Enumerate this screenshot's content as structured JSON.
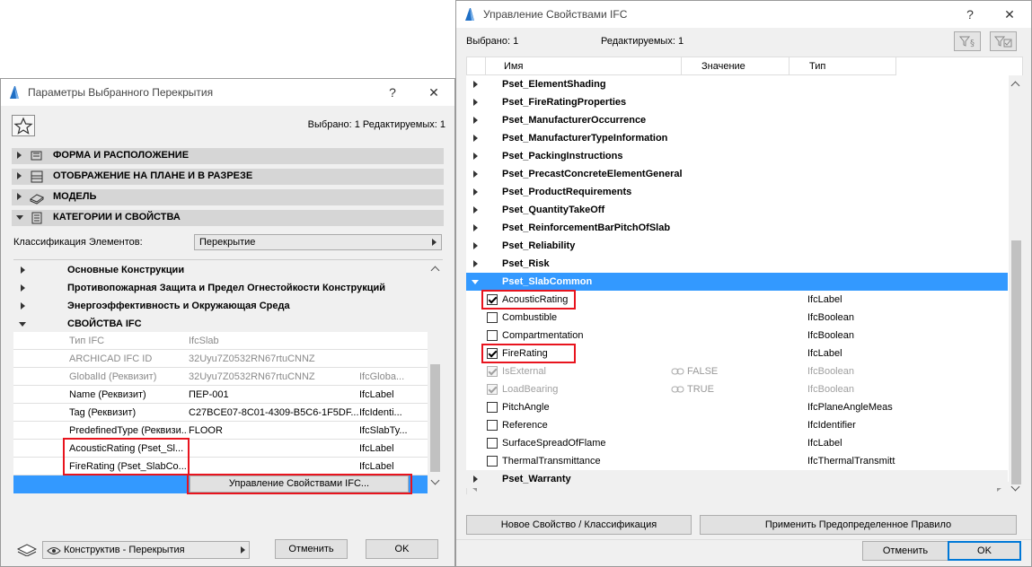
{
  "left_window": {
    "title": "Параметры Выбранного Перекрытия",
    "help": "?",
    "close": "✕",
    "selection_info": "Выбрано: 1 Редактируемых: 1",
    "sections": [
      {
        "label": "ФОРМА И РАСПОЛОЖЕНИЕ"
      },
      {
        "label": "ОТОБРАЖЕНИЕ НА ПЛАНЕ И В РАЗРЕЗЕ"
      },
      {
        "label": "МОДЕЛЬ"
      },
      {
        "label": "КАТЕГОРИИ И СВОЙСТВА"
      }
    ],
    "classification_label": "Классификация Элементов:",
    "classification_value": "Перекрытие",
    "groups": [
      {
        "label": "Основные Конструкции"
      },
      {
        "label": "Противопожарная Защита и Предел Огнестойкости Конструкций"
      },
      {
        "label": "Энергоэффективность и Окружающая Среда"
      },
      {
        "label": "СВОЙСТВА IFC"
      }
    ],
    "rows": [
      {
        "name": "Тип IFC",
        "value": "IfcSlab",
        "type": ""
      },
      {
        "name": "ARCHICAD IFC ID",
        "value": "32Uyu7Z0532RN67rtuCNNZ",
        "type": ""
      },
      {
        "name": "GlobalId (Реквизит)",
        "value": "32Uyu7Z0532RN67rtuCNNZ",
        "type": "IfcGloba..."
      },
      {
        "name": "Name (Реквизит)",
        "value": "ПЕР-001",
        "type": "IfcLabel"
      },
      {
        "name": "Tag (Реквизит)",
        "value": "C27BCE07-8C01-4309-B5C6-1F5DF...",
        "type": "IfcIdenti..."
      },
      {
        "name": "PredefinedType (Реквизи...",
        "value": "FLOOR",
        "type": "IfcSlabTy..."
      },
      {
        "name": "AcousticRating (Pset_Sl...",
        "value": "",
        "type": "IfcLabel"
      },
      {
        "name": "FireRating (Pset_SlabCo...",
        "value": "",
        "type": "IfcLabel"
      }
    ],
    "manage_button": "Управление Свойствами IFC...",
    "layer_value": "Конструктив - Перекрытия",
    "cancel": "Отменить",
    "ok": "OK"
  },
  "right_window": {
    "title": "Управление Свойствами IFC",
    "help": "?",
    "close": "✕",
    "selected_label": "Выбрано: 1",
    "editable_label": "Редактируемых: 1",
    "columns": {
      "name": "Имя",
      "value": "Значение",
      "type": "Тип"
    },
    "groups_top": [
      "Pset_ElementShading",
      "Pset_FireRatingProperties",
      "Pset_ManufacturerOccurrence",
      "Pset_ManufacturerTypeInformation",
      "Pset_PackingInstructions",
      "Pset_PrecastConcreteElementGeneral",
      "Pset_ProductRequirements",
      "Pset_QuantityTakeOff",
      "Pset_ReinforcementBarPitchOfSlab",
      "Pset_Reliability",
      "Pset_Risk"
    ],
    "selected_group": "Pset_SlabCommon",
    "properties": [
      {
        "name": "AcousticRating",
        "value": "",
        "type": "IfcLabel",
        "checked": true,
        "disabled": false
      },
      {
        "name": "Combustible",
        "value": "",
        "type": "IfcBoolean",
        "checked": false,
        "disabled": false
      },
      {
        "name": "Compartmentation",
        "value": "",
        "type": "IfcBoolean",
        "checked": false,
        "disabled": false
      },
      {
        "name": "FireRating",
        "value": "",
        "type": "IfcLabel",
        "checked": true,
        "disabled": false
      },
      {
        "name": "IsExternal",
        "value": "FALSE",
        "type": "IfcBoolean",
        "checked": true,
        "disabled": true
      },
      {
        "name": "LoadBearing",
        "value": "TRUE",
        "type": "IfcBoolean",
        "checked": true,
        "disabled": true
      },
      {
        "name": "PitchAngle",
        "value": "",
        "type": "IfcPlaneAngleMeas",
        "checked": false,
        "disabled": false
      },
      {
        "name": "Reference",
        "value": "",
        "type": "IfcIdentifier",
        "checked": false,
        "disabled": false
      },
      {
        "name": "SurfaceSpreadOfFlame",
        "value": "",
        "type": "IfcLabel",
        "checked": false,
        "disabled": false
      },
      {
        "name": "ThermalTransmittance",
        "value": "",
        "type": "IfcThermalTransmitt",
        "checked": false,
        "disabled": false
      }
    ],
    "groups_bottom": [
      "Pset_Warranty"
    ],
    "new_property_button": "Новое Свойство / Классификация",
    "apply_rule_button": "Применить Предопределенное Правило",
    "cancel": "Отменить",
    "ok": "OK"
  }
}
